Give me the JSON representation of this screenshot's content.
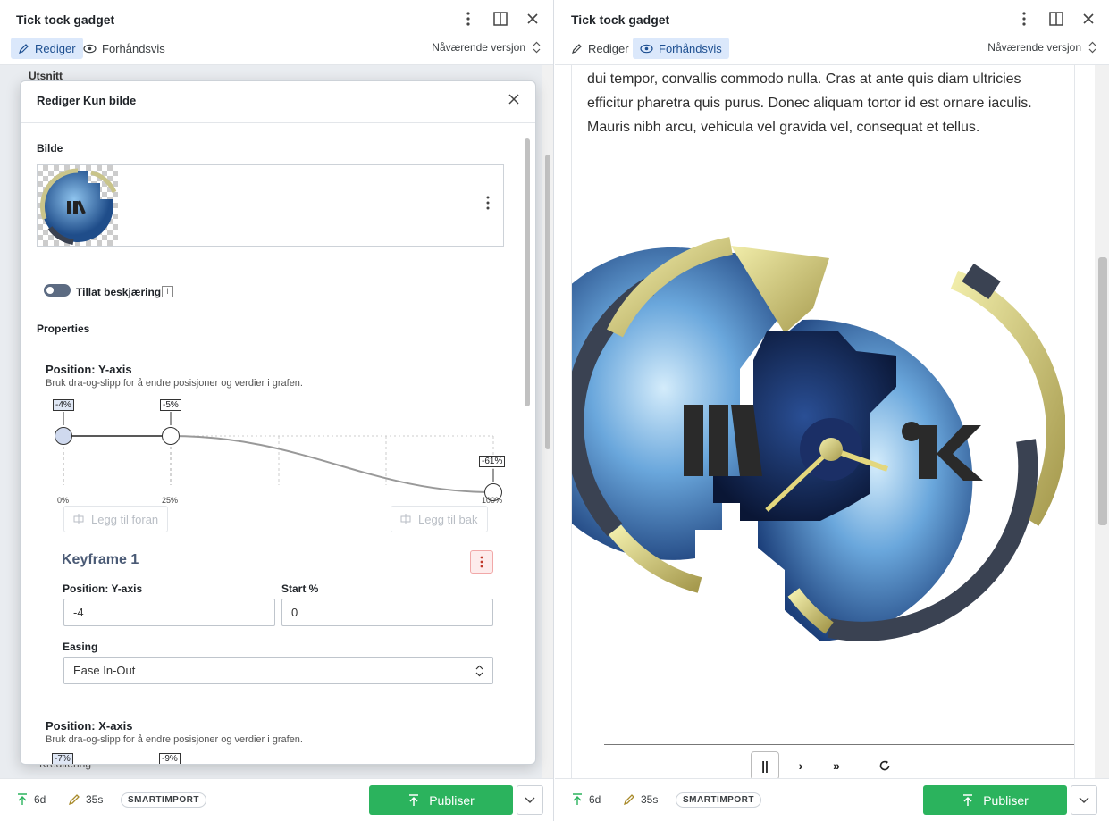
{
  "left": {
    "header": {
      "title": "Tick tock gadget"
    },
    "modes": {
      "edit": "Rediger",
      "preview": "Forhåndsvis"
    },
    "version": "Nåværende versjon",
    "background_section": "Utsnitt",
    "background_section_below": "Kreditering",
    "dialog": {
      "title": "Rediger Kun bilde",
      "image_label": "Bilde",
      "toggle_label": "Tillat beskjæring",
      "properties_label": "Properties",
      "y_axis": {
        "title": "Position: Y-axis",
        "hint": "Bruk dra-og-slipp for å endre posisjoner og verdier i grafen.",
        "keyframes": [
          {
            "value_label": "-4%",
            "position_label": "0%"
          },
          {
            "value_label": "-5%",
            "position_label": "25%"
          },
          {
            "value_label": "-61%",
            "position_label": "100%"
          }
        ],
        "add_before": "Legg til foran",
        "add_after": "Legg til bak"
      },
      "keyframe": {
        "title": "Keyframe 1",
        "field1_label": "Position: Y-axis",
        "field1_value": "-4",
        "field2_label": "Start %",
        "field2_value": "0",
        "easing_label": "Easing",
        "easing_value": "Ease In-Out"
      },
      "x_axis": {
        "title": "Position: X-axis",
        "hint": "Bruk dra-og-slipp for å endre posisjoner og verdier i grafen.",
        "value1": "-7%",
        "value2": "-9%"
      }
    },
    "footer": {
      "age": "6d",
      "edit_time": "35s",
      "badge": "SMARTIMPORT",
      "publish": "Publiser"
    }
  },
  "right": {
    "header": {
      "title": "Tick tock gadget"
    },
    "modes": {
      "edit": "Rediger",
      "preview": "Forhåndsvis"
    },
    "version": "Nåværende versjon",
    "preview_text": "dui tempor, convallis commodo nulla. Cras at ante quis diam ultricies efficitur pharetra quis purus. Donec aliquam tortor id est ornare iaculis. Mauris nibh arcu, vehicula vel gravida vel, consequat et tellus.",
    "logo_letters": "NRK",
    "controls": {
      "pause": "||",
      "next": "›",
      "fast_forward": "»"
    },
    "footer": {
      "age": "6d",
      "edit_time": "35s",
      "badge": "SMARTIMPORT",
      "publish": "Publiser"
    }
  },
  "colors": {
    "accent": "#2bb35d",
    "active_mode_bg": "#dbe8fb",
    "keyframe_title": "#4a5a75"
  }
}
